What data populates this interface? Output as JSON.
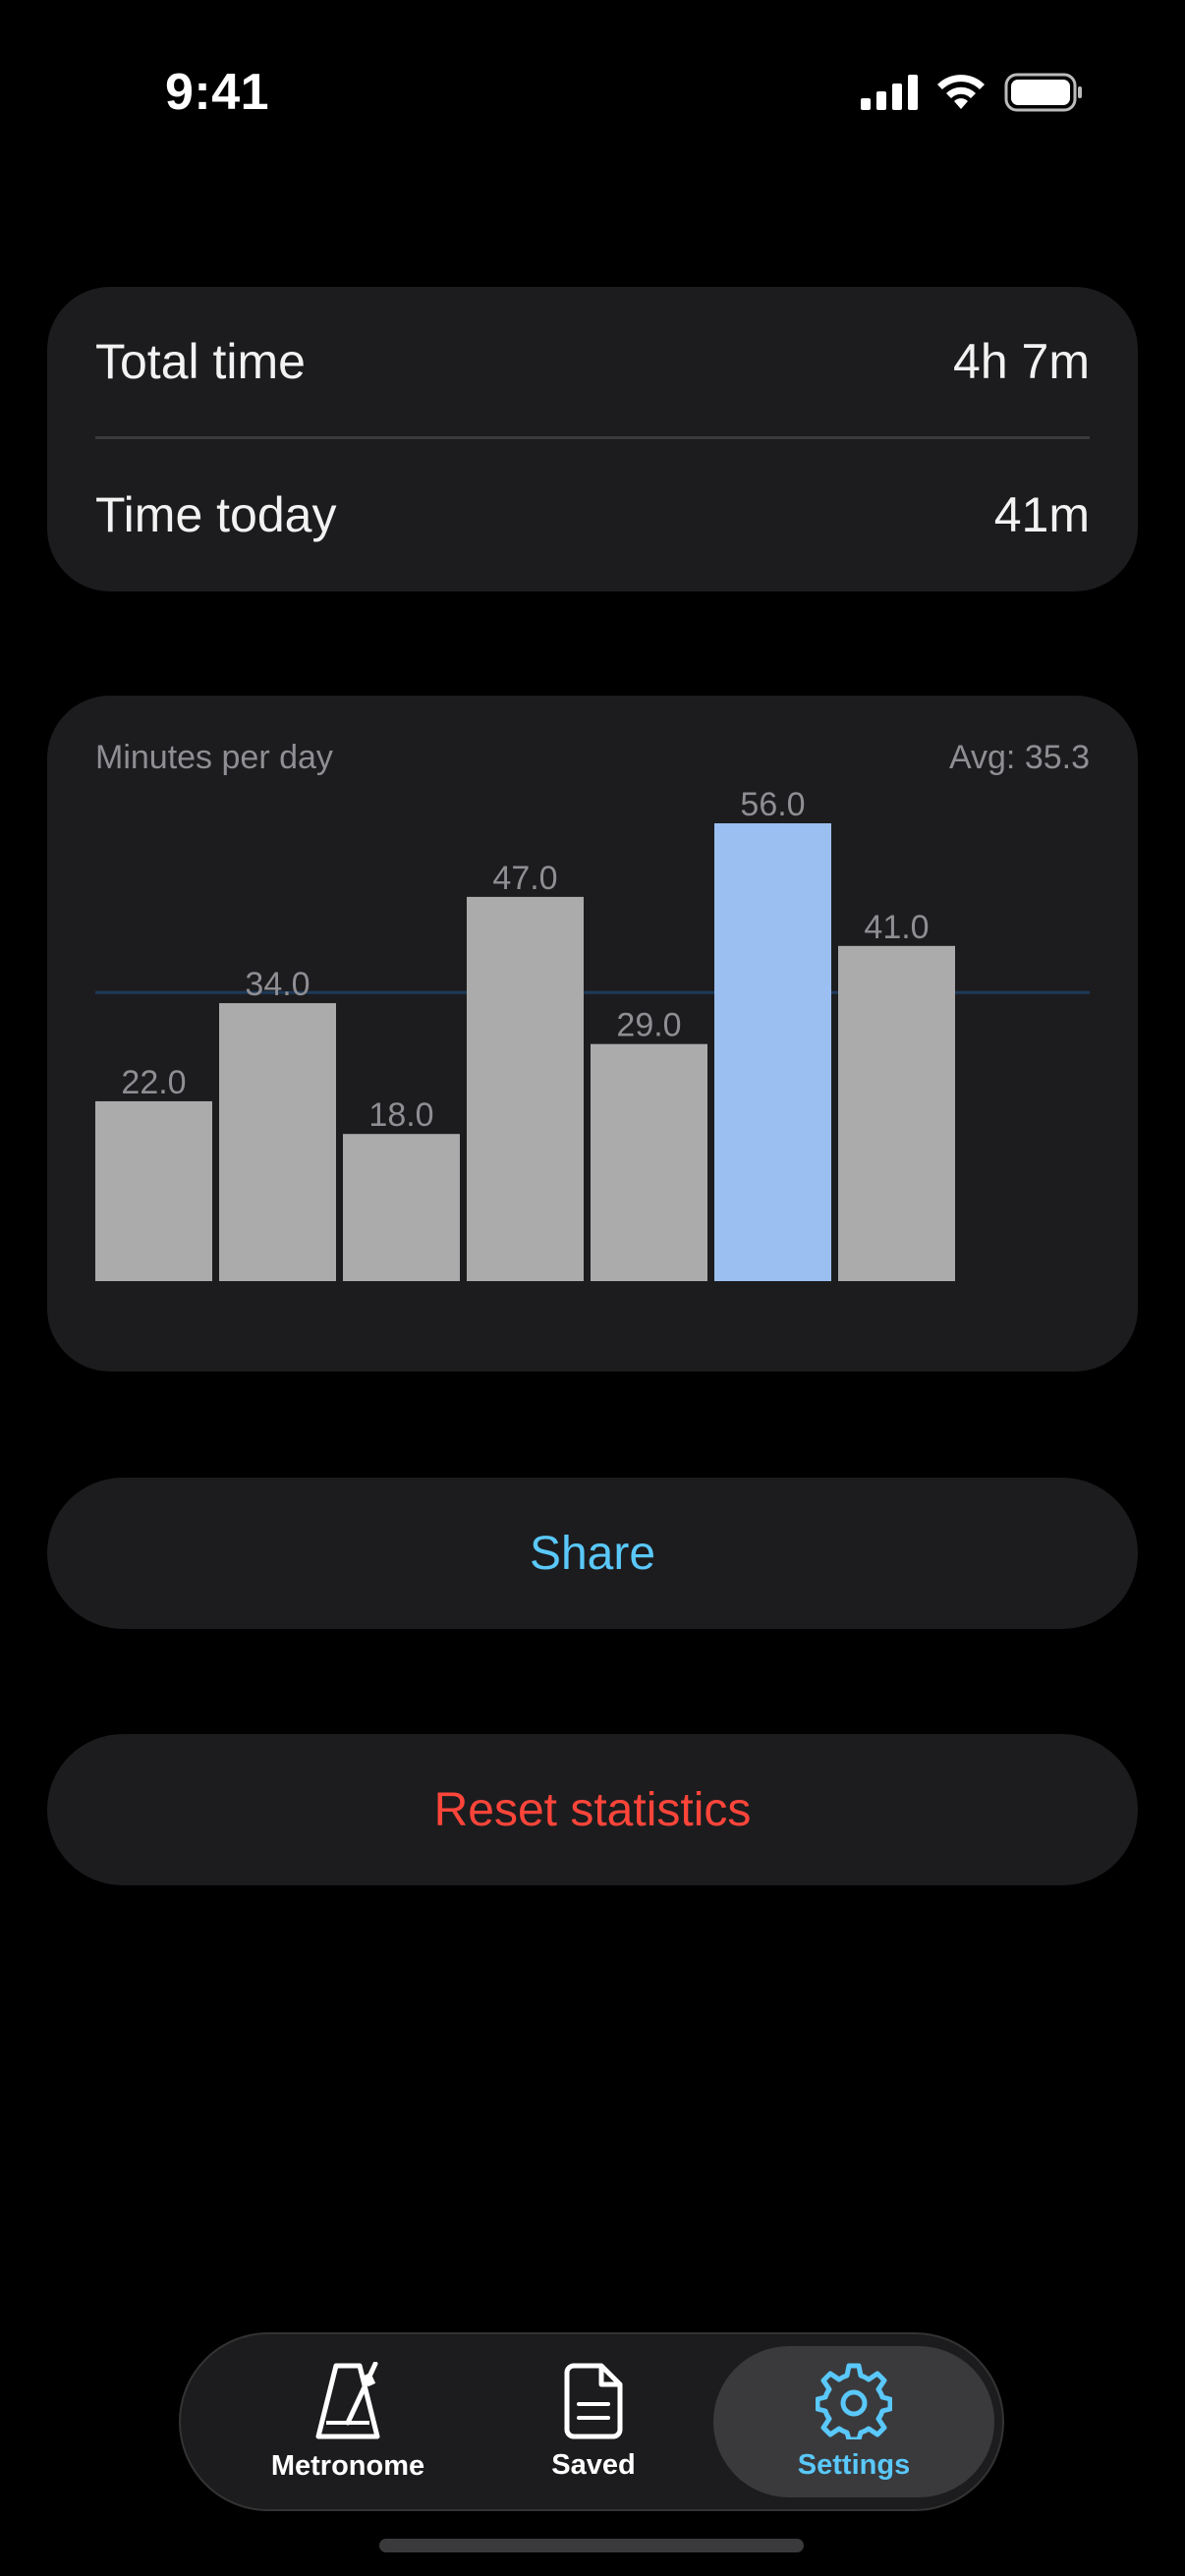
{
  "status_bar": {
    "time": "9:41"
  },
  "stats": {
    "total_time_label": "Total time",
    "total_time_value": "4h 7m",
    "time_today_label": "Time today",
    "time_today_value": "41m"
  },
  "chart_card": {
    "title": "Minutes per day",
    "avg_label": "Avg: 35.3"
  },
  "chart_data": {
    "type": "bar",
    "title": "Minutes per day",
    "values": [
      22.0,
      34.0,
      18.0,
      47.0,
      29.0,
      56.0,
      41.0
    ],
    "value_labels": [
      "22.0",
      "34.0",
      "18.0",
      "47.0",
      "29.0",
      "56.0",
      "41.0"
    ],
    "average": 35.3,
    "highlighted_index": 5,
    "ylim": [
      0,
      56
    ],
    "bar_color": "#ababab",
    "highlight_color": "#9bbff0",
    "average_line_color": "#1f3a5a"
  },
  "actions": {
    "share_label": "Share",
    "reset_label": "Reset statistics"
  },
  "tab_bar": {
    "items": [
      {
        "label": "Metronome",
        "icon": "metronome-icon"
      },
      {
        "label": "Saved",
        "icon": "document-icon"
      },
      {
        "label": "Settings",
        "icon": "gear-icon",
        "selected": true
      }
    ]
  },
  "colors": {
    "accent": "#5ac8fa",
    "destructive": "#ff453a",
    "card_background": "#1c1c1e"
  }
}
